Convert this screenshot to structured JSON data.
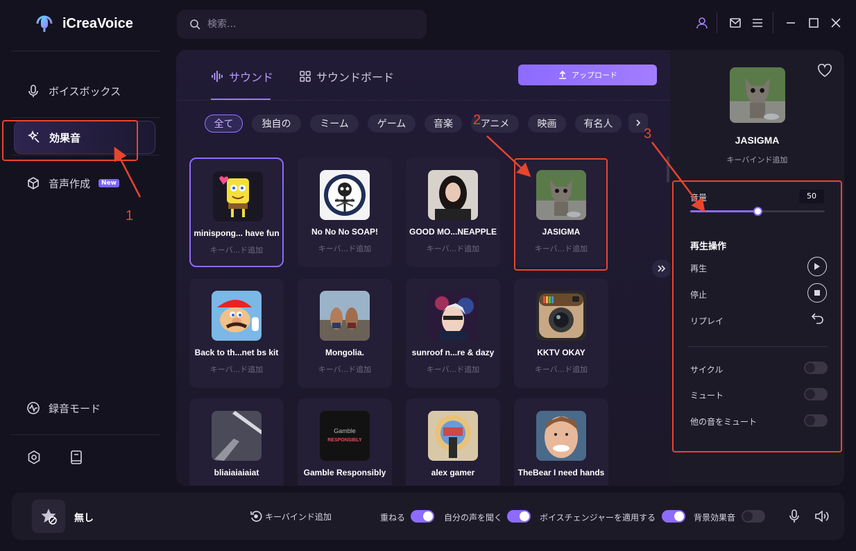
{
  "app": {
    "name": "iCreaVoice"
  },
  "search": {
    "placeholder": "検索..."
  },
  "sidebar": {
    "items": [
      {
        "label": "ボイスボックス"
      },
      {
        "label": "効果音"
      },
      {
        "label": "音声作成",
        "badge": "New"
      }
    ],
    "recording": "録音モード"
  },
  "tabs": {
    "sound": "サウンド",
    "soundboard": "サウンドボード"
  },
  "upload": {
    "label": "アップロード"
  },
  "chips": [
    "全て",
    "独自の",
    "ミーム",
    "ゲーム",
    "音楽",
    "アニメ",
    "映画",
    "有名人"
  ],
  "cards": [
    {
      "title": "minispong... have fun",
      "sub": "キーバ...ド追加"
    },
    {
      "title": "No No No SOAP!",
      "sub": "キーバ...ド追加"
    },
    {
      "title": "GOOD MO...NEAPPLE",
      "sub": "キーバ...ド追加"
    },
    {
      "title": "JASIGMA",
      "sub": "キーバ...ド追加"
    },
    {
      "title": "Back to th...net bs kit",
      "sub": "キーバ...ド追加"
    },
    {
      "title": "Mongolia.",
      "sub": "キーバ...ド追加"
    },
    {
      "title": "sunroof n...re & dazy",
      "sub": "キーバ...ド追加"
    },
    {
      "title": "KKTV OKAY",
      "sub": "キーバ...ド追加"
    },
    {
      "title": "bliaiaiaiaiat",
      "sub": ""
    },
    {
      "title": "Gamble Responsibly",
      "sub": ""
    },
    {
      "title": "alex gamer",
      "sub": ""
    },
    {
      "title": "TheBear I need hands",
      "sub": ""
    }
  ],
  "thumb_text": {
    "gamble": "Gamble",
    "responsibly": "RESPONSIBLY"
  },
  "detail": {
    "title": "JASIGMA",
    "keybind": "キーバインド追加",
    "volume_label": "音量",
    "volume_value": "50",
    "playback_title": "再生操作",
    "play": "再生",
    "stop": "停止",
    "replay": "リプレイ",
    "cycle": "サイクル",
    "mute": "ミュート",
    "mute_others": "他の音をミュート"
  },
  "volume_level": 0.5,
  "bottom": {
    "current": "無し",
    "keybind": "キーバインド追加",
    "overlap": "重ねる",
    "hear_self": "自分の声を聞く",
    "apply_changer": "ボイスチェンジャーを適用する",
    "bg_effect": "背景効果音"
  },
  "annotations": {
    "one": "1",
    "two": "2",
    "three": "3"
  },
  "colors": {
    "accent": "#8d6bff",
    "annotation": "#e8452e",
    "bg": "#15121f"
  }
}
